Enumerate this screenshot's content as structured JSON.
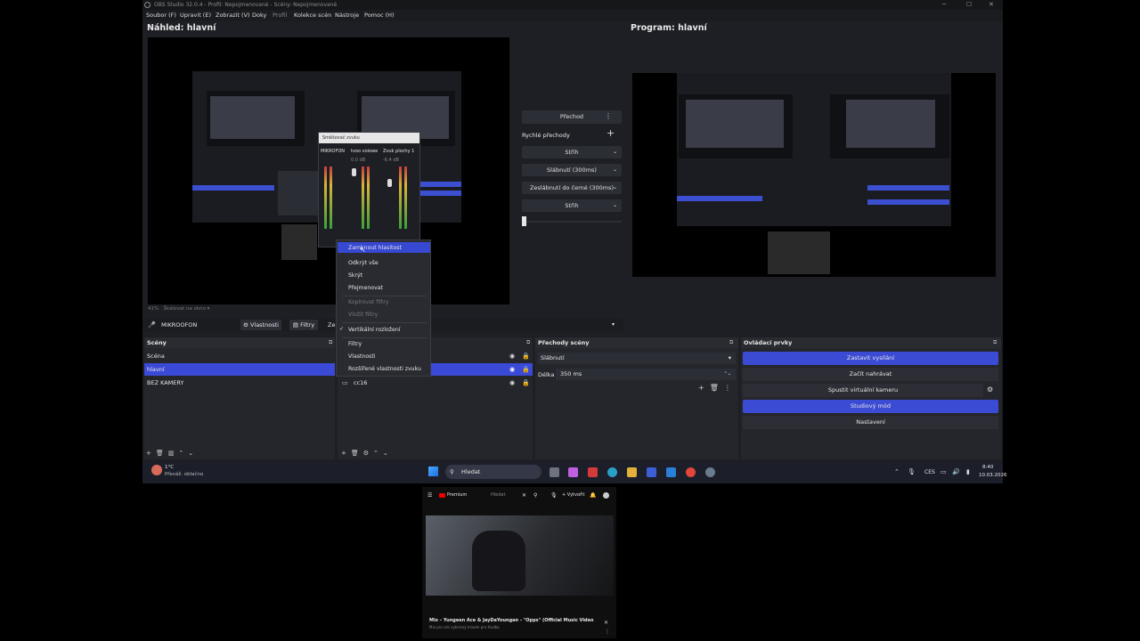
{
  "window": {
    "title": "OBS Studio 32.0.4 - Profil: Nepojmenované - Scény: Nepojmenované",
    "controls": [
      "─",
      "☐",
      "✕"
    ]
  },
  "menu": [
    "Soubor (F)",
    "Upravit (E)",
    "Zobrazit (V)",
    "Doky",
    "Profil",
    "Kolekce scén",
    "Nástroje",
    "Pomoc (H)"
  ],
  "preview": {
    "label": "Náhled: hlavní",
    "program_label": "Program: hlavní",
    "zoom_text": "41%",
    "scale_text": "Škálovat na okno"
  },
  "nested": {
    "mixer_title": "Směšovač zvuku",
    "channels": [
      "MIKROFON",
      "tvoo voiowe",
      "Zvuk plochy 1"
    ],
    "levels": [
      "0.0 dB",
      "-6.4 dB"
    ]
  },
  "transitions_center": {
    "transition_button": "Přechod",
    "quick_label": "Rychlé přechody",
    "items": [
      "Střih",
      "Slábnutí (300ms)",
      "Zeslábnutí do černé (300ms)",
      "Střih"
    ]
  },
  "source_bar": {
    "source_name": "MIKROOFON",
    "properties_label": "Vlastnosti",
    "filters_label": "Filtry",
    "extra": "Ze"
  },
  "scenes": {
    "header": "Scény",
    "items": [
      "Scéna",
      "hlavní",
      "BEZ KAMERY"
    ],
    "selected": 1
  },
  "sources": {
    "items": [
      "cc16"
    ]
  },
  "scene_transitions": {
    "header": "Přechody scény",
    "type": "Slábnutí",
    "duration_label": "Délka",
    "duration_value": "350 ms"
  },
  "controls": {
    "header": "Ovládací prvky",
    "buttons": [
      "Zastavit vysílání",
      "Začít nahrávat",
      "Spustit virtuální kameru",
      "Studiový mód",
      "Nastavení"
    ]
  },
  "context_menu": {
    "items": [
      {
        "label": "Zamknout hlasitost",
        "state": "highlighted"
      },
      {
        "label": "Odkrýt vše",
        "state": "normal"
      },
      {
        "label": "Skrýt",
        "state": "normal"
      },
      {
        "label": "Přejmenovat",
        "state": "normal"
      },
      {
        "label": "Kopírovat filtry",
        "state": "disabled"
      },
      {
        "label": "Vložit filtry",
        "state": "disabled"
      },
      {
        "label": "Vertikální rozložení",
        "state": "checked"
      },
      {
        "label": "Filtry",
        "state": "normal"
      },
      {
        "label": "Vlastnosti",
        "state": "normal"
      },
      {
        "label": "Rozšířené vlastnosti zvuku",
        "state": "normal"
      }
    ]
  },
  "taskbar": {
    "weather_temp": "1°C",
    "weather_desc": "Převáž. oblačno",
    "search_placeholder": "Hledat",
    "lang": "CES",
    "time": "8:40",
    "date": "10.03.2026"
  },
  "youtube": {
    "brand": "Premium",
    "search_hint": "Hledat",
    "create_label": "Vytvořit",
    "video_title": "Mix – Yungeen Ace & JayDaYoungan - \"Opps\" (Official Music Video)",
    "video_sub": "Mix pro vás vybíraný mixem pro Hudba"
  },
  "colors": {
    "accent": "#3b4ad6",
    "window_bg": "#1e1f24",
    "dock_bg": "#25262c"
  }
}
